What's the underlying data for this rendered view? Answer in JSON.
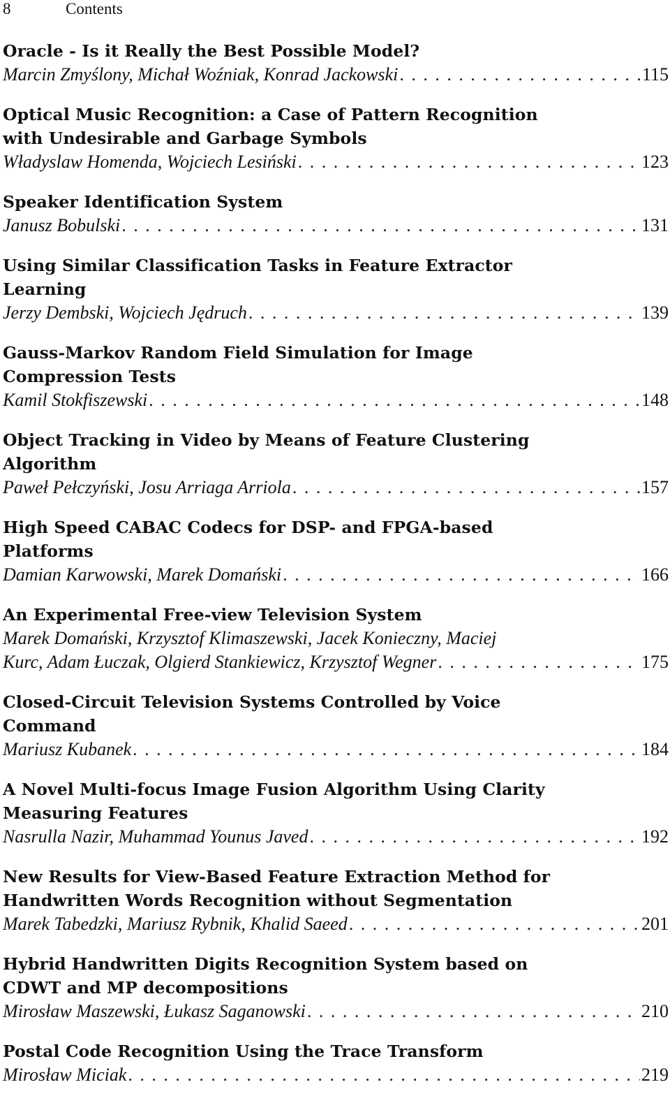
{
  "header": {
    "page_number": "8",
    "running_title": "Contents"
  },
  "entries": [
    {
      "title_lines": [
        "Oracle - Is it Really the Best Possible Model?"
      ],
      "author_lines": [
        "Marcin Zmyślony, Michał Woźniak, Konrad Jackowski"
      ],
      "page": "115"
    },
    {
      "title_lines": [
        "Optical Music Recognition: a Case of Pattern Recognition",
        "with Undesirable and Garbage Symbols"
      ],
      "author_lines": [
        "Władyslaw Homenda, Wojciech Lesiński"
      ],
      "page": "123"
    },
    {
      "title_lines": [
        "Speaker Identification System"
      ],
      "author_lines": [
        "Janusz Bobulski"
      ],
      "page": "131"
    },
    {
      "title_lines": [
        "Using Similar Classification Tasks in Feature Extractor",
        "Learning"
      ],
      "author_lines": [
        "Jerzy Dembski, Wojciech Jędruch"
      ],
      "page": "139"
    },
    {
      "title_lines": [
        "Gauss-Markov Random Field Simulation for Image",
        "Compression Tests"
      ],
      "author_lines": [
        "Kamil Stokfiszewski"
      ],
      "page": "148"
    },
    {
      "title_lines": [
        "Object Tracking in Video by Means of Feature Clustering",
        "Algorithm"
      ],
      "author_lines": [
        "Paweł Pełczyński, Josu Arriaga Arriola"
      ],
      "page": "157"
    },
    {
      "title_lines": [
        "High Speed CABAC Codecs for DSP- and FPGA-based",
        "Platforms"
      ],
      "author_lines": [
        "Damian Karwowski, Marek Domański"
      ],
      "page": "166"
    },
    {
      "title_lines": [
        "An Experimental Free-view Television System"
      ],
      "author_lines": [
        "Marek Domański, Krzysztof Klimaszewski, Jacek Konieczny, Maciej",
        "Kurc, Adam Łuczak, Olgierd Stankiewicz, Krzysztof Wegner"
      ],
      "page": "175"
    },
    {
      "title_lines": [
        "Closed-Circuit Television Systems Controlled by Voice",
        "Command"
      ],
      "author_lines": [
        "Mariusz Kubanek"
      ],
      "page": "184"
    },
    {
      "title_lines": [
        "A Novel Multi-focus Image Fusion Algorithm Using Clarity",
        "Measuring Features"
      ],
      "author_lines": [
        "Nasrulla Nazir, Muhammad Younus Javed"
      ],
      "page": "192"
    },
    {
      "title_lines": [
        "New Results for View-Based Feature Extraction Method for",
        "Handwritten Words Recognition without Segmentation"
      ],
      "author_lines": [
        "Marek Tabedzki, Mariusz Rybnik, Khalid Saeed"
      ],
      "page": "201"
    },
    {
      "title_lines": [
        "Hybrid Handwritten Digits Recognition System based on",
        "CDWT and MP decompositions"
      ],
      "author_lines": [
        "Mirosław Maszewski, Łukasz Saganowski"
      ],
      "page": "210"
    },
    {
      "title_lines": [
        "Postal Code Recognition Using the Trace Transform"
      ],
      "author_lines": [
        "Mirosław Miciak"
      ],
      "page": "219"
    }
  ]
}
